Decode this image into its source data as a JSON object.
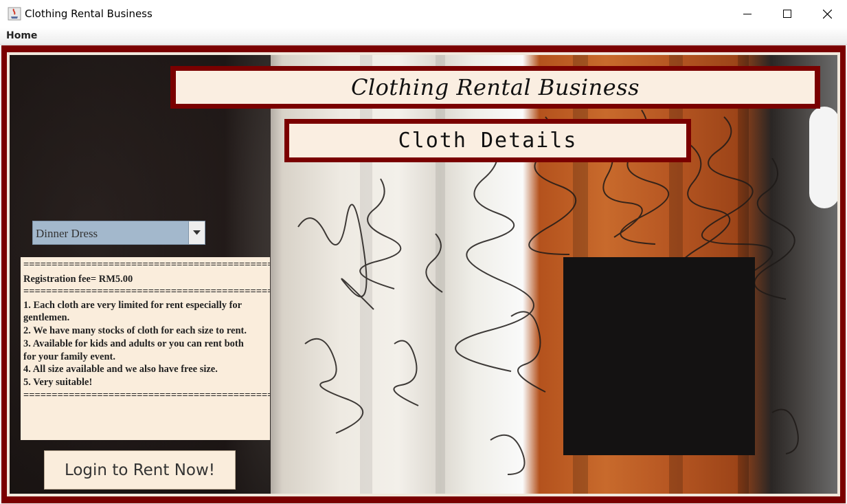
{
  "window": {
    "title": "Clothing Rental Business",
    "icon": "java-cup-icon",
    "controls": [
      "minimize-icon",
      "maximize-icon",
      "close-icon"
    ]
  },
  "menu": {
    "home": "Home"
  },
  "header": {
    "title": "Clothing Rental Business",
    "subtitle": "Cloth Details"
  },
  "category_select": {
    "value": "Dinner Dress"
  },
  "info": {
    "lines": [
      "=================================================",
      " Registration fee= RM5.00",
      "=================================================",
      "1. Each cloth are very limited for rent especially for",
      "gentlemen.",
      "2. We have many stocks of cloth for each size to rent.",
      "3. Available for kids and adults or  you can rent both",
      "for your family event.",
      "4. All size available and we also have free size.",
      "5. Very suitable!",
      "================================================="
    ]
  },
  "login_button": {
    "label": "Login to Rent Now!"
  },
  "colors": {
    "frame": "#7a0000",
    "panel": "#faeddc",
    "combo": "#a3b8cc"
  }
}
